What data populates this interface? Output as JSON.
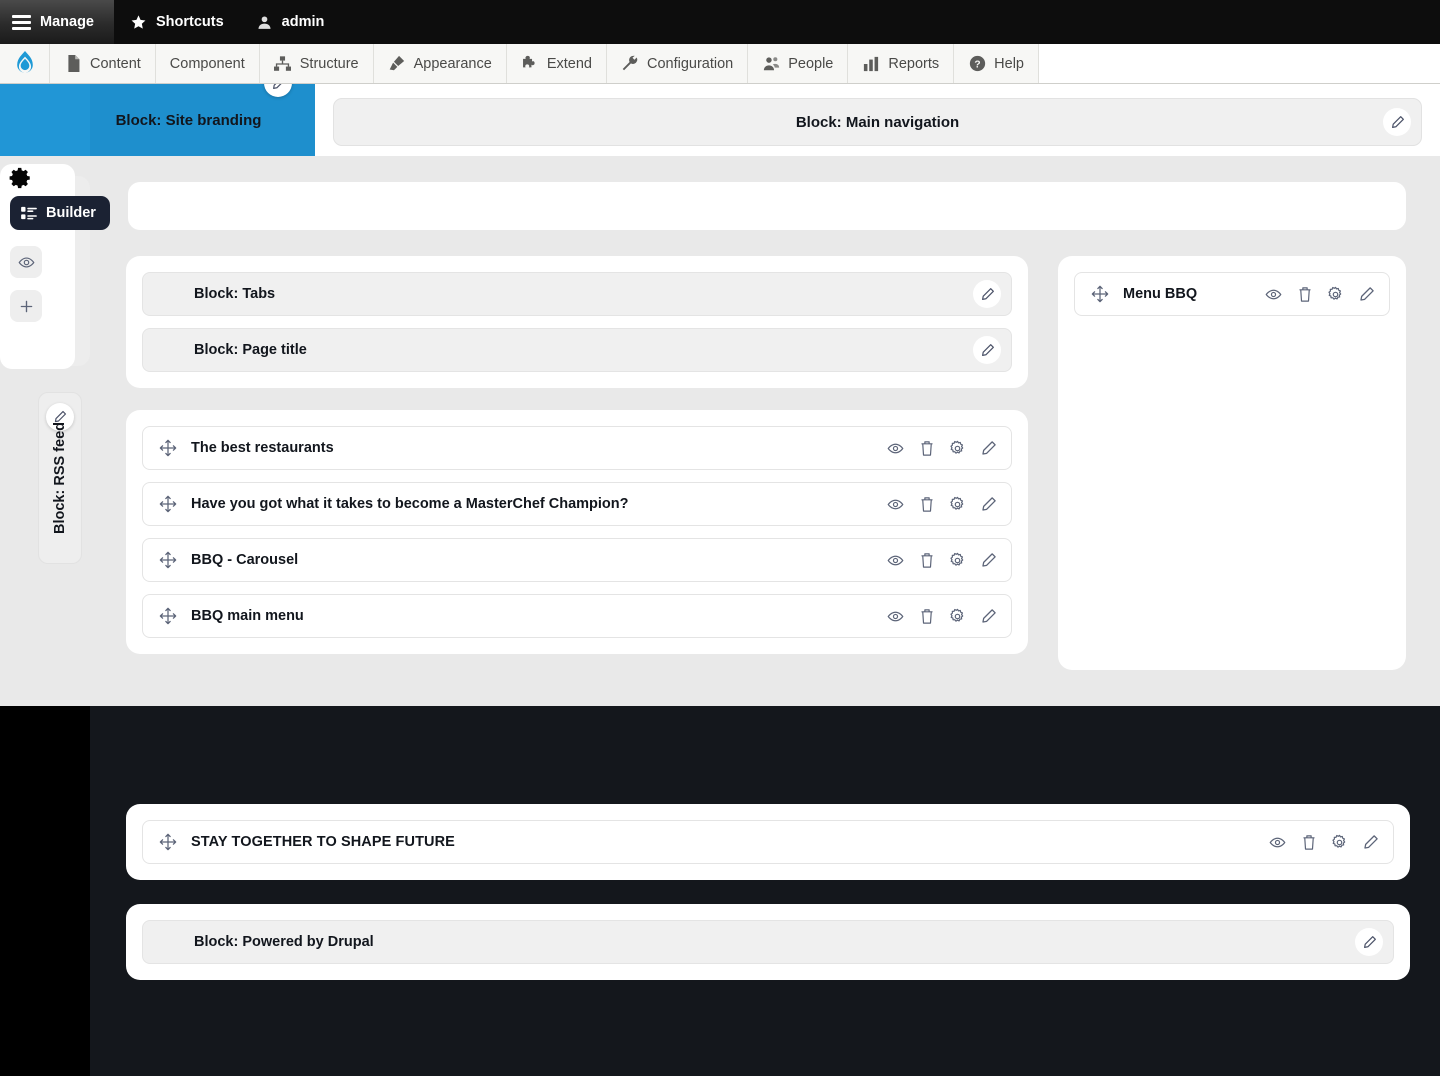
{
  "admin_bar": {
    "items": [
      {
        "label": "Manage",
        "icon": "hamburger-icon"
      },
      {
        "label": "Shortcuts",
        "icon": "star-icon"
      },
      {
        "label": "admin",
        "icon": "user-icon"
      }
    ]
  },
  "menu_bar": {
    "logo_icon": "drupal-drop-icon",
    "items": [
      {
        "label": "Content",
        "icon": "page-icon"
      },
      {
        "label": "Component",
        "icon": "none"
      },
      {
        "label": "Structure",
        "icon": "structure-icon"
      },
      {
        "label": "Appearance",
        "icon": "paintbrush-icon"
      },
      {
        "label": "Extend",
        "icon": "puzzle-icon"
      },
      {
        "label": "Configuration",
        "icon": "wrench-icon"
      },
      {
        "label": "People",
        "icon": "people-icon"
      },
      {
        "label": "Reports",
        "icon": "bar-chart-icon"
      },
      {
        "label": "Help",
        "icon": "question-circle-icon"
      }
    ]
  },
  "left_rail": {
    "gear_icon": "gear-icon",
    "builder": {
      "label": "Builder",
      "icon": "layout-list-icon"
    },
    "preview_icon": "eye-icon",
    "add_icon": "plus-icon",
    "rss_block": {
      "label": "Block: RSS feed",
      "edit_icon": "pencil-icon"
    }
  },
  "header": {
    "branding": {
      "label": "Block: Site branding",
      "edit_icon": "pencil-icon"
    },
    "navigation": {
      "label": "Block: Main navigation",
      "edit_icon": "pencil-icon"
    }
  },
  "main": {
    "meta_panel": {
      "rows": [
        {
          "label": "Block: Tabs",
          "edit_icon": "pencil-icon"
        },
        {
          "label": "Block: Page title",
          "edit_icon": "pencil-icon"
        }
      ]
    },
    "content_panel": {
      "rows": [
        {
          "label": "The best restaurants"
        },
        {
          "label": "Have you got what it takes to become a MasterChef Champion?"
        },
        {
          "label": "BBQ - Carousel"
        },
        {
          "label": "BBQ main menu"
        }
      ]
    },
    "side_panel": {
      "rows": [
        {
          "label": "Menu BBQ"
        }
      ]
    }
  },
  "footer": {
    "rows": [
      {
        "label": "STAY TOGETHER TO SHAPE FUTURE"
      }
    ],
    "powered": {
      "label": "Block: Powered by Drupal",
      "edit_icon": "pencil-icon"
    }
  },
  "row_actions": {
    "view": "eye-icon",
    "delete": "trash-icon",
    "configure": "gear-icon",
    "edit": "pencil-icon"
  },
  "colors": {
    "brand_blue": "#2196d6",
    "brand_blue_dark": "#1e8fcd",
    "builder_pill": "#1b2233",
    "dark_region": "#14171c",
    "grey_region": "#e9e9e9",
    "icon_stroke": "#5c6478"
  }
}
